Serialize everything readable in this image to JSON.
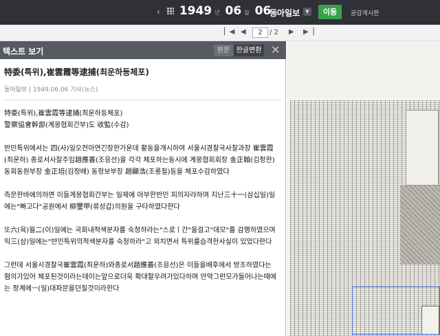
{
  "topbar": {
    "year": "1949",
    "year_unit": "년",
    "month": "06",
    "month_unit": "월",
    "day": "06",
    "day_unit": "일",
    "newspaper": "동아일보",
    "go_label": "이동",
    "share_label": "공감게시판"
  },
  "pagination": {
    "current": "2",
    "total": "/ 2"
  },
  "panel": {
    "title": "텍스트 보기",
    "tab_original": "원문",
    "tab_korean": "한글변환"
  },
  "article": {
    "title": "特委(특위),崔雲霞等逮捕(최운하등체포)",
    "meta": "동아일보 | 1949.06.06 기사(뉴스)",
    "lead1": "特委(특위),崔雲霞等逮捕(최운하등체포)",
    "lead2": "警察協會幹部(계몽협회간부)도 收監(수감)",
    "p1": "반민특위에서는 四(사)일오전아연긴장한가운데 활동을개시하여 서울시경찰국사찰과장 崔雲霞(최운하) 종로서사찰주임趙應善(조응선)을 각각 체포하는동시에 계몽협회회장 金正翰(김정한)동회동원부장 金正培(김정배) 동정보부장 趙顯浩(조롱철)등을 체포수감하였다",
    "p2": "측문한바에의하면 이들계몽협회간부는 일제에 아부한반민 피의자라하며 지난三十一(삼십일)일에는\"빠고다\"공원에서 柳璽甲(류성갑)의원을 구타하였다한다",
    "p3": "또六(육)월二(이)일에는 국회내적색분자를 숙청하라는\"스로ㅣ간\"을걸고\"데모\"를 감행하였으며 익三(삼)일에는\"반민특위의적색분자를 숙청하라\"고 외치면서 특위를습격한사실이 있었다한다",
    "p4": "그런데 서울시경찰국崔雲霞(최운하)와종로서趙應善(조응선)은 이들을배후에서 방조하였다는 혐의가있어 체포된것이라는데이는앞으로더욱 확대할우려가있다하며 만약그런모가들어나는때에는 정계에ㅡ(일)대파문을던질것이라한다"
  }
}
